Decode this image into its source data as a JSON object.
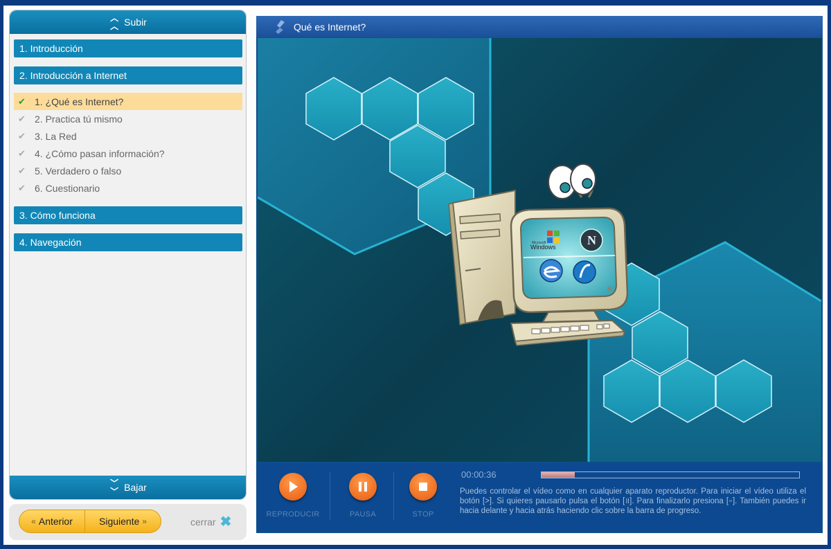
{
  "sidebar": {
    "up_label": "Subir",
    "down_label": "Bajar",
    "sections": [
      {
        "label": "1. Introducción"
      },
      {
        "label": "2. Introducción a Internet"
      },
      {
        "label": "3. Cómo funciona"
      },
      {
        "label": "4. Navegación"
      }
    ],
    "lessons": [
      {
        "label": "1. ¿Qué es Internet?",
        "active": true
      },
      {
        "label": "2. Practica tú mismo",
        "active": false
      },
      {
        "label": "3. La Red",
        "active": false
      },
      {
        "label": "4. ¿Cómo pasan información?",
        "active": false
      },
      {
        "label": "5. Verdadero o falso",
        "active": false
      },
      {
        "label": "6. Cuestionario",
        "active": false
      }
    ]
  },
  "nav": {
    "prev_label": "Anterior",
    "next_label": "Siguiente",
    "close_label": "cerrar"
  },
  "player": {
    "title": "Qué es Internet?",
    "controls": {
      "play_label": "REPRODUCIR",
      "pause_label": "PAUSA",
      "stop_label": "STOP"
    },
    "time": "00:00:36",
    "progress": 0.13,
    "help_text": "Puedes controlar el vídeo como en cualquier aparato reproductor. Para iniciar el vídeo utiliza el botón [>]. Si quieres pausarlo pulsa el botón [॥]. Para finalizarlo presiona [▫]. También puedes ir hacia delante y hacia atrás haciendo clic sobre la barra de progreso."
  },
  "video_screen": {
    "windows_small": "Microsoft",
    "windows_label": "Windows",
    "netscape_letter": "N"
  },
  "colors": {
    "accent": "#1287b7",
    "highlight": "#fddc9a",
    "control_orange": "#f0701f",
    "background": "#0b3a80"
  }
}
